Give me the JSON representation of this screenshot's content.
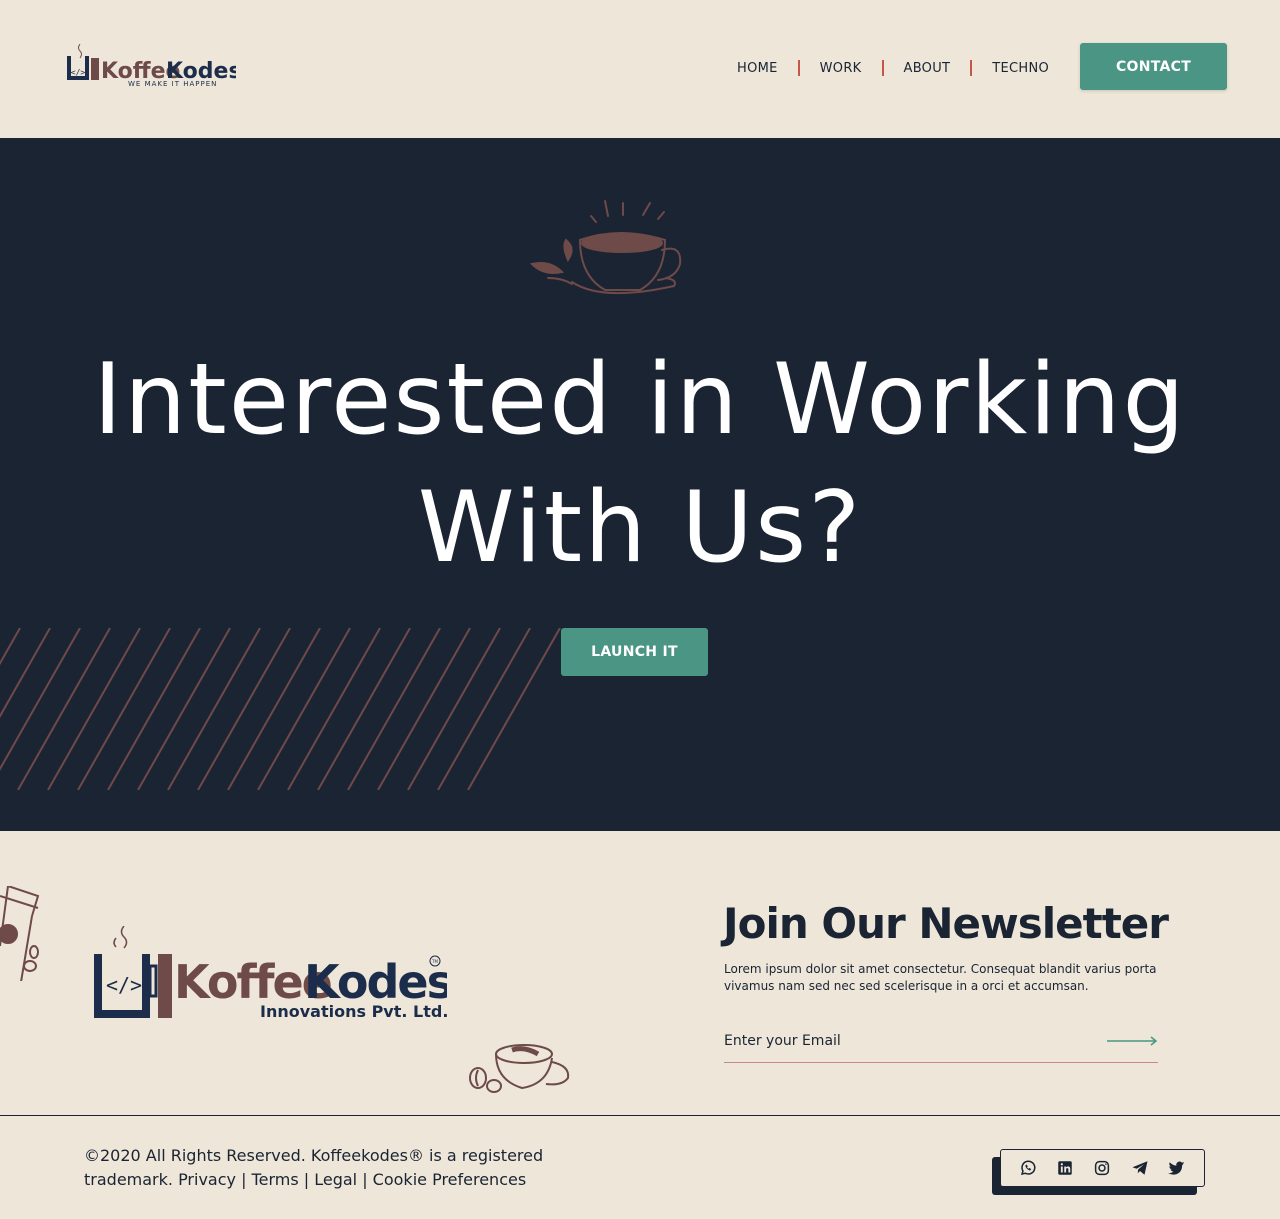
{
  "brand": {
    "name_part1": "Koffee",
    "name_part2": "Kodes",
    "tagline": "WE MAKE IT HAPPEN",
    "company_line": "Innovations Pvt. Ltd.",
    "trademark": "TM"
  },
  "nav": {
    "items": [
      {
        "label": "HOME"
      },
      {
        "label": "WORK"
      },
      {
        "label": "ABOUT"
      },
      {
        "label": "TECHNO"
      }
    ],
    "contact_label": "CONTACT"
  },
  "hero": {
    "title_line1": "Interested in Working",
    "title_line2": "With Us?",
    "cta_label": "LAUNCH IT"
  },
  "newsletter": {
    "title": "Join Our Newsletter",
    "text": "Lorem ipsum dolor sit amet consectetur. Consequat blandit varius porta vivamus nam sed nec sed scelerisque in a orci et accumsan.",
    "email_placeholder": "Enter your Email"
  },
  "footer": {
    "copyright_line1": "©2020 All Rights Reserved. Koffeekodes® is a registered",
    "copyright_line2": "trademark. Privacy | Terms | Legal | Cookie Preferences",
    "social": [
      "whatsapp-icon",
      "linkedin-icon",
      "instagram-icon",
      "telegram-icon",
      "twitter-icon"
    ]
  },
  "colors": {
    "navy": "#1b2433",
    "cream": "#ede6d9",
    "teal": "#4a9583",
    "brown": "#6e4a48",
    "separator": "#c8554a"
  }
}
